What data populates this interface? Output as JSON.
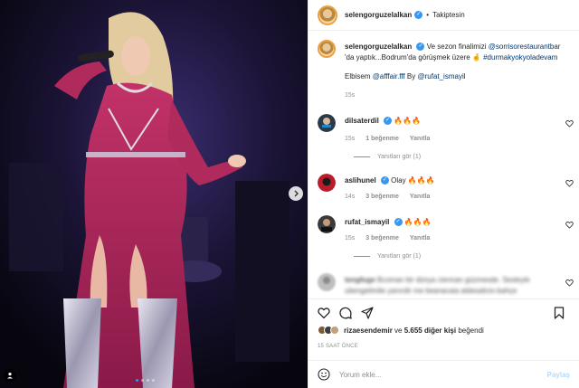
{
  "post": {
    "username": "selengorguzelalkan",
    "follow_status": "Takiptesin",
    "caption_prefix": "Ve sezon finalimizi ",
    "caption_mention": "@sorrisorestaurantbar",
    "caption_mid": " 'da yaptık...Bodrum'da görüşmek üzere 🤞 ",
    "caption_hashtag": "#durmakyokyoladevam",
    "caption_line2_prefix": "Elbisem ",
    "caption_line2_mention1": "@afffair.fff",
    "caption_line2_by": " By ",
    "caption_line2_mention2": "@rufat_ismayil",
    "caption_time": "15s"
  },
  "comments": [
    {
      "username": "dilsaterdil",
      "text": "🔥🔥🔥",
      "time": "15s",
      "likes": "1 beğenme",
      "reply": "Yanıtla",
      "view_replies": "Yanıtları gör (1)"
    },
    {
      "username": "aslihunel",
      "text": "Olay 🔥🔥🔥",
      "time": "14s",
      "likes": "3 beğenme",
      "reply": "Yanıtla"
    },
    {
      "username": "rufat_ismayil",
      "text": "🔥🔥🔥",
      "time": "15s",
      "likes": "3 beğenme",
      "reply": "Yanıtla",
      "view_replies": "Yanıtları gör (1)"
    },
    {
      "username": "tengfuge",
      "text": "Bcoman bir dünya ciennan güzmesde. Sesleyle ubengelimile yanırdir me beanacaia aldesalicio-bahçe"
    }
  ],
  "likes": {
    "user": "rizaesendemir",
    "joiner": " ve ",
    "others": "5.655 diğer kişi",
    "suffix": " beğendi"
  },
  "timestamp": "15 SAAT ÖNCE",
  "composer": {
    "placeholder": "Yorum ekle...",
    "post_label": "Paylaş"
  },
  "icons": {
    "verified": "verified-badge-icon",
    "heart": "heart-icon",
    "comment": "comment-icon",
    "share": "paper-plane-icon",
    "save": "bookmark-icon",
    "emoji": "smiley-icon",
    "next": "chevron-right-icon",
    "tag": "user-tag-icon"
  },
  "colors": {
    "verified_blue": "#3897f0",
    "link": "#00376b",
    "muted": "#8e8e8e",
    "post_btn": "#b3dbff",
    "carousel_active": "#3b8ef5"
  },
  "carousel": {
    "slides": 4,
    "active": 1
  }
}
